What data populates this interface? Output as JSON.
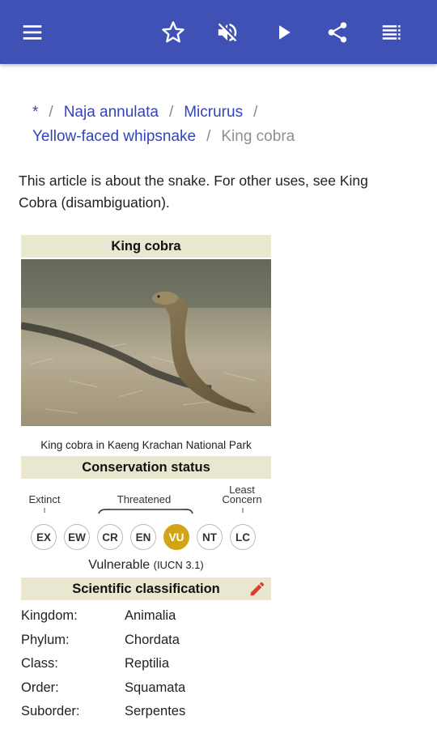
{
  "toolbar": {
    "icons": [
      "menu-icon",
      "star-icon",
      "volume-off-icon",
      "play-icon",
      "share-icon",
      "contents-icon"
    ],
    "accent": "#3f51b5"
  },
  "breadcrumb": {
    "items": [
      "*",
      "Naja annulata",
      "Micrurus",
      "Yellow-faced whipsnake"
    ],
    "separator": "/",
    "current": "King cobra"
  },
  "hatnote": "This article is about the snake. For other uses, see King Cobra (disambiguation).",
  "infobox": {
    "title": "King cobra",
    "caption": "King cobra in Kaeng Krachan National Park",
    "conservation_header": "Conservation status",
    "labels": {
      "extinct": "Extinct",
      "threatened": "Threatened",
      "least_concern": "Least Concern"
    },
    "statuses": [
      "EX",
      "EW",
      "CR",
      "EN",
      "VU",
      "NT",
      "LC"
    ],
    "active_status": "VU",
    "active_color": "#d4a417",
    "status_text": "Vulnerable",
    "status_source": "(IUCN 3.1)",
    "classification_header": "Scientific classification",
    "header_bg": "#e9e7cf"
  },
  "taxonomy": [
    {
      "rank": "Kingdom:",
      "value": "Animalia"
    },
    {
      "rank": "Phylum:",
      "value": "Chordata"
    },
    {
      "rank": "Class:",
      "value": "Reptilia"
    },
    {
      "rank": "Order:",
      "value": "Squamata"
    },
    {
      "rank": "Suborder:",
      "value": "Serpentes"
    }
  ]
}
